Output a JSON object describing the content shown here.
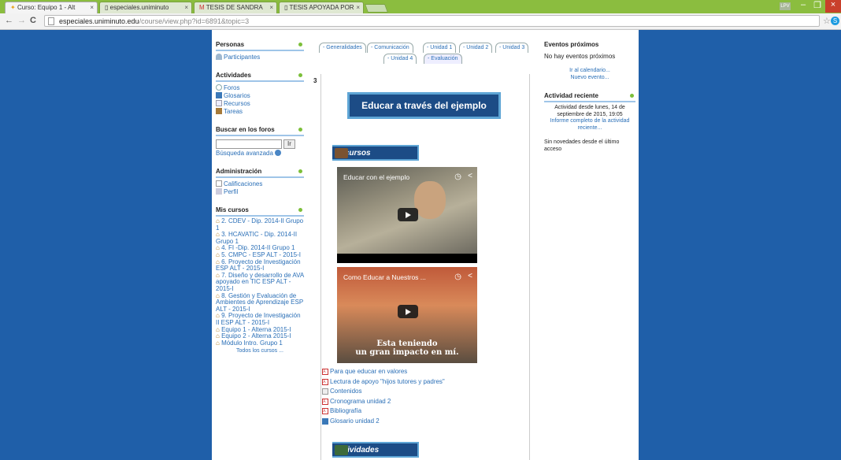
{
  "browser": {
    "tabs": [
      {
        "label": "Curso: Equipo 1 - Alt",
        "active": true
      },
      {
        "label": "especiales.uniminuto",
        "active": false
      },
      {
        "label": "TESIS DE SANDRA",
        "active": false
      },
      {
        "label": "TESIS APOYADA POR",
        "active": false
      }
    ],
    "url_host": "especiales.uniminuto.edu",
    "url_path": "/course/view.php?id=6891&topic=3",
    "window_controls": [
      "–",
      "❐",
      "×"
    ]
  },
  "left": {
    "personas": {
      "title": "Personas",
      "items": [
        {
          "label": "Participantes",
          "icon": "participants-icon"
        }
      ]
    },
    "actividades": {
      "title": "Actividades",
      "items": [
        {
          "label": "Foros",
          "icon": "forum-icon"
        },
        {
          "label": "Glosarios",
          "icon": "glossary-icon"
        },
        {
          "label": "Recursos",
          "icon": "resource-icon"
        },
        {
          "label": "Tareas",
          "icon": "assignment-icon"
        }
      ]
    },
    "buscar": {
      "title": "Buscar en los foros",
      "button": "Ir",
      "advanced": "Búsqueda avanzada"
    },
    "admin": {
      "title": "Administración",
      "items": [
        {
          "label": "Calificaciones",
          "icon": "grades-icon"
        },
        {
          "label": "Perfil",
          "icon": "profile-icon"
        }
      ]
    },
    "mis_cursos": {
      "title": "Mis cursos",
      "items": [
        "2. CDEV - Dip. 2014-II Grupo 1",
        "3. HCAVATIC - Dip. 2014-II Grupo 1",
        "4. FI -Dip. 2014-II Grupo 1",
        "5. CMPC - ESP ALT - 2015-I",
        "6. Proyecto de Investigación ESP ALT - 2015-I",
        "7. Diseño y desarrollo de AVA apoyado en TIC ESP ALT - 2015-I",
        "8. Gestión y Evaluación de Ambientes de Aprendizaje ESP ALT - 2015-I",
        "9. Proyecto de Investigación II ESP ALT - 2015-I",
        "Equipo 1 - Alterna 2015-I",
        "Equipo 2 - Alterna 2015-I",
        "Módulo Intro. Grupo 1"
      ],
      "all": "Todos los cursos ..."
    }
  },
  "center": {
    "tabs_row1": [
      "- Generalidades",
      "- Comunicación",
      "- Unidad 1",
      "- Unidad 2",
      "- Unidad 3"
    ],
    "tabs_row2": [
      "- Unidad 4",
      "- Evaluación"
    ],
    "section_number": "3",
    "banner": "Educar a través del ejemplo",
    "recursos_label": "Recursos",
    "video1": {
      "title": "Educar con el ejemplo"
    },
    "video2": {
      "title": "Como Educar a Nuestros ...",
      "caption_line1": "Esta teniendo",
      "caption_line2": "un gran impacto en mí."
    },
    "resources": [
      {
        "label": "Para que educar en valores",
        "icon": "pdf-icon"
      },
      {
        "label": "Lectura de apoyo \"hijos tutores y padres\"",
        "icon": "pdf-icon"
      },
      {
        "label": "Contenidos",
        "icon": "content-icon"
      },
      {
        "label": "Cronograma unidad 2",
        "icon": "pdf-icon"
      },
      {
        "label": "Bibliografía",
        "icon": "pdf-icon"
      },
      {
        "label": "Glosario unidad 2",
        "icon": "glossary-icon"
      }
    ],
    "actividades_label": "Actividades"
  },
  "right": {
    "eventos": {
      "title": "Eventos próximos",
      "empty": "No hay eventos próximos",
      "calendar": "Ir al calendario...",
      "new_event": "Nuevo evento..."
    },
    "actividad": {
      "title": "Actividad reciente",
      "since": "Actividad desde lunes, 14 de septiembre de 2015, 19:05",
      "report": "Informe completo de la actividad reciente...",
      "none": "Sin novedades desde el último acceso"
    }
  }
}
